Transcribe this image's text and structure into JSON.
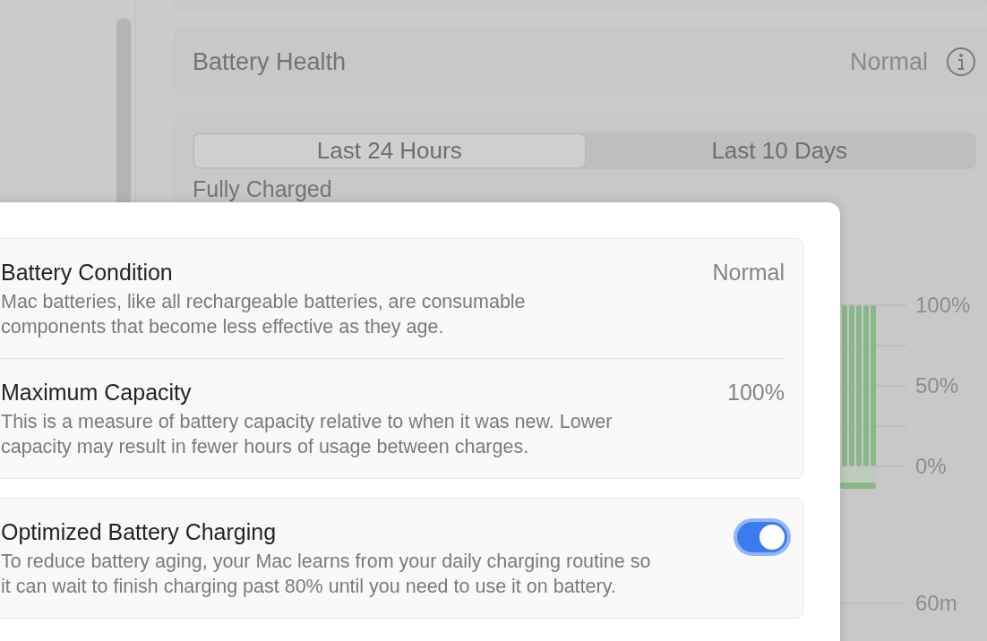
{
  "battery_health": {
    "label": "Battery Health",
    "value": "Normal"
  },
  "history": {
    "tabs": [
      {
        "label": "Last 24 Hours",
        "selected": true
      },
      {
        "label": "Last 10 Days",
        "selected": false
      }
    ],
    "heading": "Fully Charged",
    "level_axis": [
      "100%",
      "50%",
      "0%"
    ],
    "time_axis": [
      "60m"
    ]
  },
  "sheet": {
    "sections": [
      {
        "rows": [
          {
            "kind": "info",
            "title": "Battery Condition",
            "value": "Normal",
            "description": "Mac batteries, like all rechargeable batteries, are consumable components that become less effective as they age."
          },
          {
            "kind": "info",
            "title": "Maximum Capacity",
            "value": "100%",
            "description": "This is a measure of battery capacity relative to when it was new. Lower capacity may result in fewer hours of usage between charges."
          }
        ]
      },
      {
        "rows": [
          {
            "kind": "toggle",
            "title": "Optimized Battery Charging",
            "on": true,
            "description": "To reduce battery aging, your Mac learns from your daily charging routine so it can wait to finish charging past 80% until you need to use it on battery."
          }
        ]
      }
    ]
  }
}
